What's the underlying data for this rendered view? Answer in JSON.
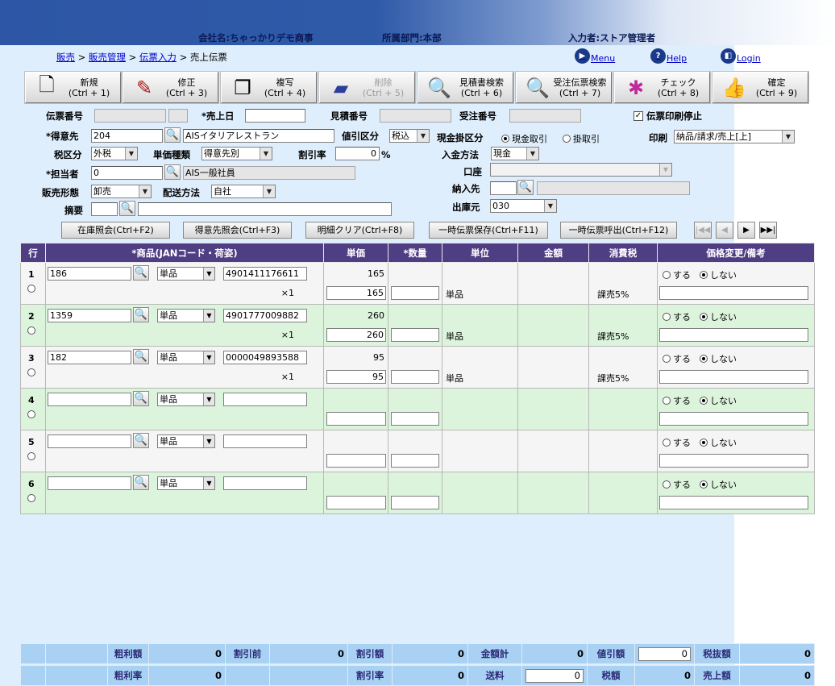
{
  "header": {
    "company": "会社名:ちゃっかりデモ商事",
    "department": "所属部門:本部",
    "operator": "入力者:ストア管理者"
  },
  "breadcrumb": {
    "items": [
      "販売",
      "販売管理",
      "伝票入力"
    ],
    "current": "売上伝票"
  },
  "links": {
    "menu": "Menu",
    "help": "Help",
    "login": "Login"
  },
  "toolbar": [
    {
      "label": "新規\n(Ctrl + 1)",
      "icon": "new-document-icon",
      "disabled": false
    },
    {
      "label": "修正\n(Ctrl + 3)",
      "icon": "pencil-icon",
      "disabled": false
    },
    {
      "label": "複写\n(Ctrl + 4)",
      "icon": "copy-icon",
      "disabled": false
    },
    {
      "label": "削除\n(Ctrl + 5)",
      "icon": "eraser-icon",
      "disabled": true
    },
    {
      "label": "見積書検索\n(Ctrl + 6)",
      "icon": "magnifier-icon",
      "disabled": false
    },
    {
      "label": "受注伝票検索\n(Ctrl + 7)",
      "icon": "magnifier-icon",
      "disabled": false
    },
    {
      "label": "チェック\n(Ctrl + 8)",
      "icon": "check-puzzle-icon",
      "disabled": false
    },
    {
      "label": "確定\n(Ctrl + 9)",
      "icon": "thumbs-up-icon",
      "disabled": false
    }
  ],
  "form": {
    "slip_no_label": "伝票番号",
    "sales_date_label": "*売上日",
    "quote_no_label": "見積番号",
    "order_no_label": "受注番号",
    "print_stop_label": "伝票印刷停止",
    "print_stop_checked": true,
    "customer_label": "*得意先",
    "customer_code": "204",
    "customer_name": "AISイタリアレストラン",
    "discount_div_label": "値引区分",
    "discount_div_value": "税込",
    "cash_credit_label": "現金掛区分",
    "cash_option": "現金取引",
    "credit_option": "掛取引",
    "print_label": "印刷",
    "print_value": "納品/請求/売上[上]",
    "tax_div_label": "税区分",
    "tax_div_value": "外税",
    "price_type_label": "単価種類",
    "price_type_value": "得意先別",
    "discount_rate_label": "割引率",
    "discount_rate_value": "0",
    "discount_rate_unit": "%",
    "payment_method_label": "入金方法",
    "payment_method_value": "現金",
    "staff_label": "*担当者",
    "staff_code": "0",
    "staff_name": "AIS一般社員",
    "account_label": "口座",
    "sales_form_label": "販売形態",
    "sales_form_value": "卸売",
    "delivery_method_label": "配送方法",
    "delivery_method_value": "自社",
    "delivery_dest_label": "納入先",
    "summary_label": "摘要",
    "warehouse_label": "出庫元",
    "warehouse_value": "030"
  },
  "actions": [
    "在庫照会(Ctrl+F2)",
    "得意先照会(Ctrl+F3)",
    "明細クリア(Ctrl+F8)",
    "一時伝票保存(Ctrl+F11)",
    "一時伝票呼出(Ctrl+F12)"
  ],
  "pager": [
    "|◀◀",
    "◀",
    "▶",
    "▶▶|"
  ],
  "grid": {
    "headers": [
      "行",
      "*商品(JANコード・荷姿)",
      "単価",
      "*数量",
      "単位",
      "金額",
      "消費税",
      "価格変更/備考"
    ],
    "rows": [
      {
        "no": "1",
        "code": "186",
        "unit_sel": "単品",
        "jan": "4901411176611",
        "mult": "×1",
        "price": "165",
        "price_in": "165",
        "unit": "単品",
        "tax": "課売5%",
        "opt_yes": "する",
        "opt_no": "しない"
      },
      {
        "no": "2",
        "code": "1359",
        "unit_sel": "単品",
        "jan": "4901777009882",
        "mult": "×1",
        "price": "260",
        "price_in": "260",
        "unit": "単品",
        "tax": "課売5%",
        "opt_yes": "する",
        "opt_no": "しない"
      },
      {
        "no": "3",
        "code": "182",
        "unit_sel": "単品",
        "jan": "0000049893588",
        "mult": "×1",
        "price": "95",
        "price_in": "95",
        "unit": "単品",
        "tax": "課売5%",
        "opt_yes": "する",
        "opt_no": "しない"
      },
      {
        "no": "4",
        "code": "",
        "unit_sel": "単品",
        "jan": "",
        "mult": "",
        "price": "",
        "price_in": "",
        "unit": "",
        "tax": "",
        "opt_yes": "する",
        "opt_no": "しない"
      },
      {
        "no": "5",
        "code": "",
        "unit_sel": "単品",
        "jan": "",
        "mult": "",
        "price": "",
        "price_in": "",
        "unit": "",
        "tax": "",
        "opt_yes": "する",
        "opt_no": "しない"
      },
      {
        "no": "6",
        "code": "",
        "unit_sel": "単品",
        "jan": "",
        "mult": "",
        "price": "",
        "price_in": "",
        "unit": "",
        "tax": "",
        "opt_yes": "する",
        "opt_no": "しない"
      }
    ]
  },
  "totals": {
    "gross_profit_label": "粗利額",
    "gross_profit": "0",
    "before_discount_label": "割引前",
    "before_discount": "0",
    "discount_amount_label": "割引額",
    "discount_amount": "0",
    "amount_total_label": "金額計",
    "amount_total": "0",
    "price_discount_label": "値引額",
    "price_discount": "0",
    "excl_tax_label": "税抜額",
    "excl_tax": "0",
    "gross_rate_label": "粗利率",
    "gross_rate": "0",
    "discount_rate_label": "割引率",
    "discount_rate": "0",
    "shipping_label": "送料",
    "shipping": "0",
    "tax_label": "税額",
    "tax": "0",
    "sales_label": "売上額",
    "sales": "0"
  }
}
